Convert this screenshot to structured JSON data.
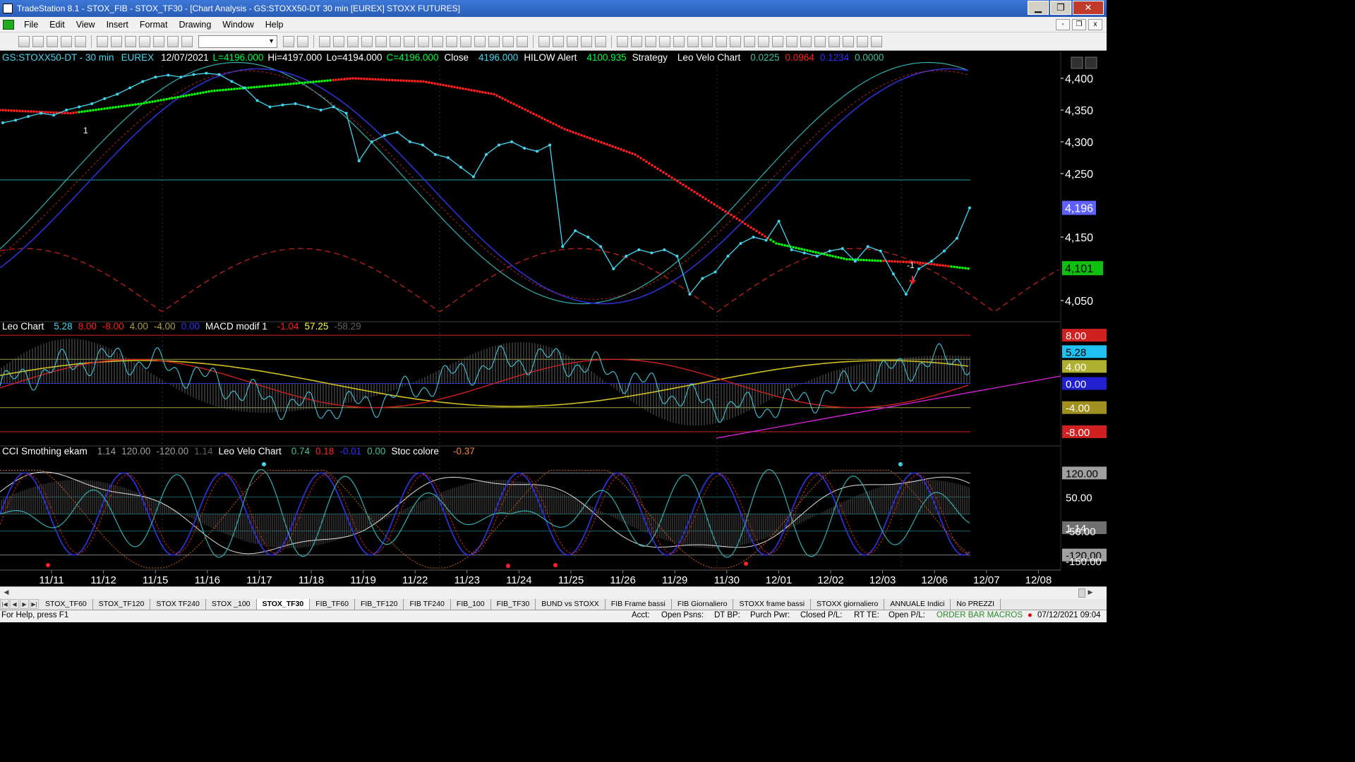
{
  "window": {
    "title": "TradeStation 8.1 - STOX_FIB - STOX_TF30 - [Chart Analysis - GS:STOXX50-DT  30 min  [EUREX] STOXX FUTURES]",
    "buttons": {
      "minimize": "▁",
      "restore": "❐",
      "close": "✕"
    }
  },
  "menu": [
    "File",
    "Edit",
    "View",
    "Insert",
    "Format",
    "Drawing",
    "Window",
    "Help"
  ],
  "mdi_buttons": {
    "minimize": "-",
    "restore": "❐",
    "close": "x"
  },
  "status_left": "For Help, press F1",
  "status": {
    "acct": "Acct:",
    "open_psns": "Open Psns:",
    "dt_bp": "DT BP:",
    "purch_pwr": "Purch Pwr:",
    "closed_pl": "Closed P/L:",
    "rt_te": "RT TE:",
    "open_pl": "Open P/L:",
    "macros": "ORDER BAR  MACROS",
    "datetime": "07/12/2021 09:04"
  },
  "tabs": [
    "STOX_TF60",
    "STOX_TF120",
    "STOX TF240",
    "STOX _100",
    "STOX_TF30",
    "FIB_TF60",
    "FIB_TF120",
    "FIB TF240",
    "FIB_100",
    "FIB_TF30",
    "BUND vs STOXX",
    "FIB Frame bassi",
    "FIB Giornaliero",
    "STOXX frame bassi",
    "STOXX giornaliero",
    "ANNUALE Indici",
    "No PREZZI"
  ],
  "active_tab": "STOX_TF30",
  "colors": {
    "up_green": "#00ff00",
    "price_cyan": "#40d8f0",
    "trend_red": "#ff2020",
    "ma_blue": "#3030d0",
    "yellow": "#ffff40",
    "magenta": "#e020e0"
  },
  "chart_data": [
    {
      "type": "line",
      "panel": "price",
      "header": {
        "symbol": "GS:STOXX50-DT - 30 min",
        "exchange": "EUREX",
        "date": "12/07/2021",
        "last": "L=4196.000",
        "high": "Hi=4197.000",
        "low": "Lo=4194.000",
        "close": "C=4196.000",
        "close_label": "Close",
        "close_value": "4196.000",
        "alert_label": "HILOW Alert",
        "alert_value": "4100.935",
        "strategy": "Strategy",
        "leo_label": "Leo Velo Chart",
        "leo_values": [
          "0.0225",
          "0.0964",
          "0.1234",
          "0.0000"
        ]
      },
      "ylim": [
        4020,
        4420
      ],
      "y_ticks": [
        "4,400",
        "4,350",
        "4,300",
        "4,250",
        "4,196",
        "4,150",
        "4,101",
        "4,050"
      ],
      "x_labels": [
        "11/11",
        "11/12",
        "11/15",
        "11/16",
        "11/17",
        "11/18",
        "11/19",
        "11/22",
        "11/23",
        "11/24",
        "11/25",
        "11/26",
        "11/29",
        "11/30",
        "12/01",
        "12/02",
        "12/03",
        "12/06",
        "12/07",
        "12/08"
      ],
      "last_price": "4,196",
      "hilow_alert": "4,101",
      "signals": [
        "1",
        "-1"
      ],
      "close_series": [
        4330,
        4334,
        4340,
        4345,
        4342,
        4350,
        4355,
        4360,
        4368,
        4375,
        4385,
        4395,
        4402,
        4405,
        4402,
        4406,
        4408,
        4406,
        4395,
        4385,
        4365,
        4355,
        4358,
        4360,
        4355,
        4350,
        4355,
        4345,
        4270,
        4300,
        4310,
        4315,
        4300,
        4295,
        4280,
        4275,
        4260,
        4245,
        4280,
        4295,
        4300,
        4290,
        4285,
        4295,
        4135,
        4160,
        4150,
        4135,
        4100,
        4120,
        4130,
        4125,
        4130,
        4120,
        4060,
        4085,
        4095,
        4120,
        4140,
        4150,
        4145,
        4175,
        4130,
        4125,
        4120,
        4128,
        4132,
        4112,
        4135,
        4128,
        4092,
        4060,
        4100,
        4112,
        4128,
        4148,
        4196
      ]
    },
    {
      "type": "line",
      "panel": "oscillator-1",
      "header": {
        "name": "Leo Chart",
        "values": [
          "5.28",
          "8.00",
          "-8.00",
          "4.00",
          "-4.00",
          "0.00"
        ],
        "macd_label": "MACD modif 1",
        "macd_values": [
          "-1.04",
          "57.25",
          "-58.29"
        ]
      },
      "ylim": [
        -10,
        10
      ],
      "levels": [
        "8.00",
        "5.28",
        "4.00",
        "0.00",
        "-4.00",
        "-8.00"
      ]
    },
    {
      "type": "line",
      "panel": "oscillator-2",
      "header": {
        "name": "CCI Smothing ekam",
        "values": [
          "1.14",
          "120.00",
          "-120.00",
          "1.14"
        ],
        "leo_label": "Leo Velo Chart",
        "leo_values": [
          "0.74",
          "0.18",
          "-0.01",
          "0.00"
        ],
        "stoc_label": "Stoc colore",
        "stoc_value": "-0.37"
      },
      "ylim": [
        -160,
        160
      ],
      "levels": [
        "120.00",
        "50.00",
        "1.14",
        "-50.00",
        "-120.00",
        "-150.00"
      ]
    }
  ]
}
